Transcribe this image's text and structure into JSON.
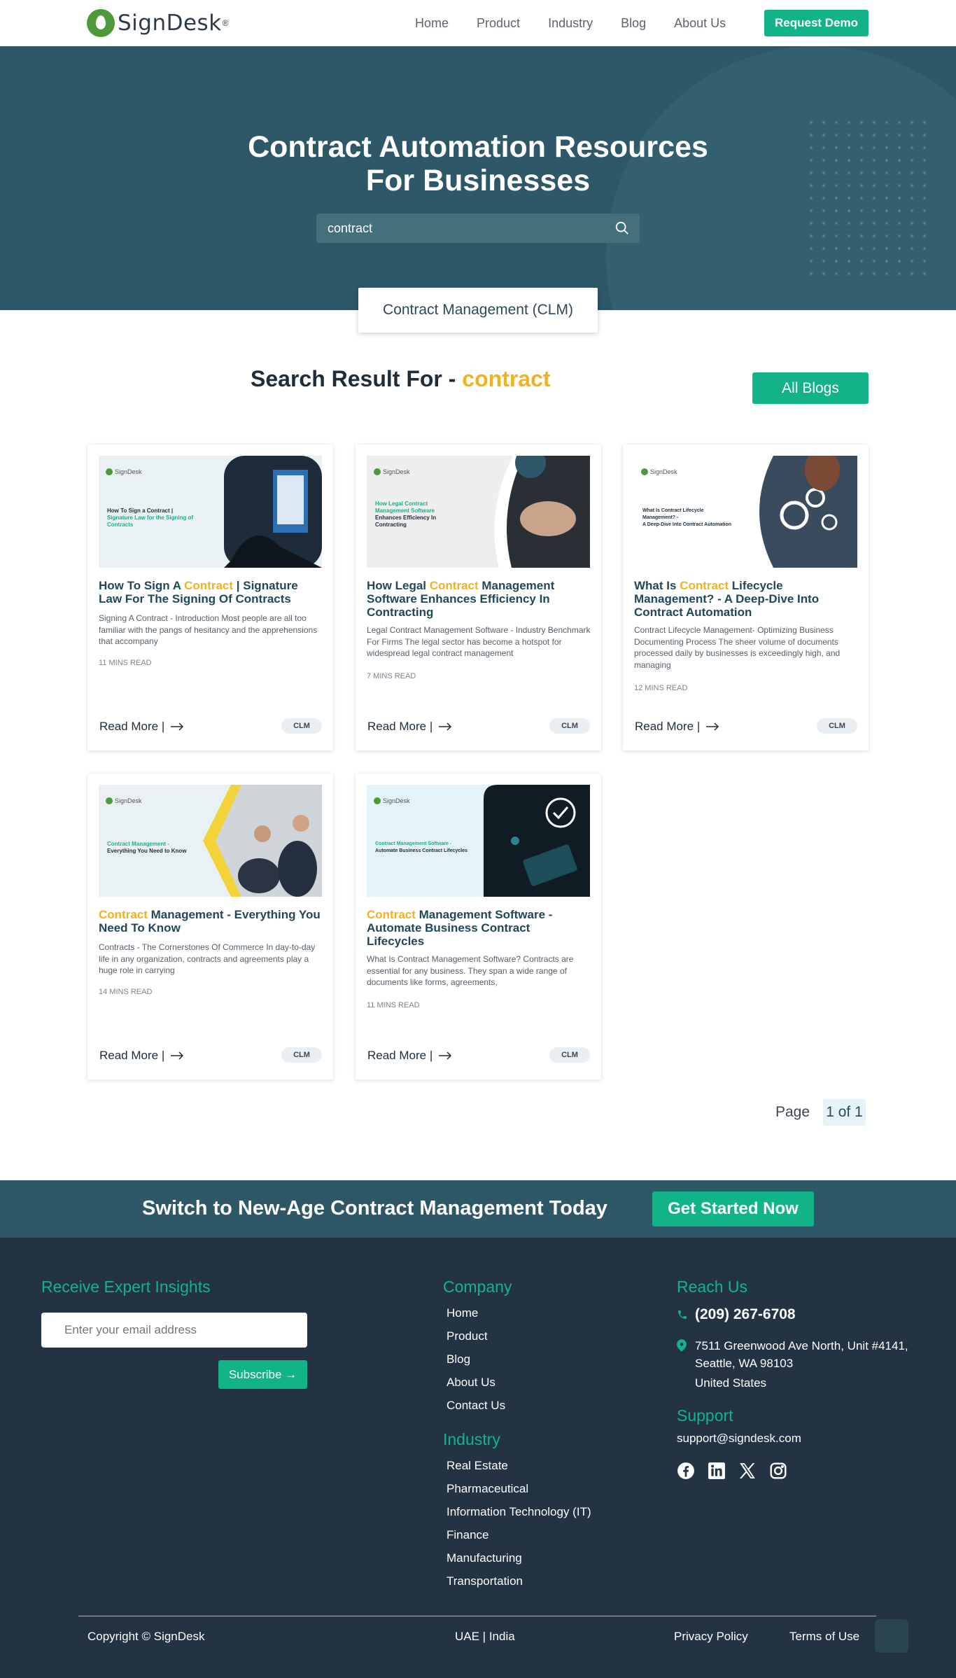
{
  "header": {
    "brand": "SignDesk",
    "brand_mark": "®",
    "nav": [
      "Home",
      "Product",
      "Industry",
      "Blog",
      "About Us"
    ],
    "demo_label": "Request Demo"
  },
  "hero": {
    "title_line1": "Contract Automation Resources",
    "title_line2": "For Businesses",
    "search_value": "contract",
    "tab_label": "Contract Management (CLM)"
  },
  "results": {
    "prefix": "Search Result For - ",
    "keyword": "contract",
    "all_blogs_label": "All Blogs"
  },
  "cards": [
    {
      "title_pre": "How To Sign A ",
      "title_kw": "Contract",
      "title_post": " | Signature Law For The Signing Of Contracts",
      "thumb_brand": "SignDesk",
      "thumb_line1": "How To Sign a Contract |",
      "thumb_line2": "Signature Law for the Signing of Contracts",
      "desc": "Signing A Contract - Introduction Most people are all too familiar with the pangs of hesitancy and the apprehensions that accompany",
      "read": "11 MINS READ",
      "more": "Read More |",
      "tag": "CLM"
    },
    {
      "title_pre": "How Legal ",
      "title_kw": "Contract",
      "title_post": " Management Software Enhances Efficiency In Contracting",
      "thumb_brand": "SignDesk",
      "thumb_line1": "How Legal Contract Management Software",
      "thumb_line2": "Enhances Efficiency In Contracting",
      "desc": "Legal Contract Management Software - Industry Benchmark For Firms The legal sector has become a hotspot for widespread legal contract management",
      "read": "7 MINS READ",
      "more": "Read More |",
      "tag": "CLM"
    },
    {
      "title_pre": "What Is ",
      "title_kw": "Contract",
      "title_post": " Lifecycle Management? - A Deep-Dive Into Contract Automation",
      "thumb_brand": "SignDesk",
      "thumb_line1": "What Is Contract Lifecycle Management? -",
      "thumb_line2": "A Deep-Dive Into Contract Automation",
      "desc": "Contract Lifecycle Management- Optimizing Business Documenting Process The sheer volume of documents processed daily by businesses is exceedingly high, and managing",
      "read": "12 MINS READ",
      "more": "Read More |",
      "tag": "CLM"
    },
    {
      "title_pre": "",
      "title_kw": "Contract",
      "title_post": " Management - Everything You Need To Know",
      "thumb_brand": "SignDesk",
      "thumb_line1": "Contract Management -",
      "thumb_line2": "Everything You Need to Know",
      "desc": "Contracts - The Cornerstones Of Commerce In day-to-day life in any organization, contracts and agreements play a huge role in carrying",
      "read": "14 MINS READ",
      "more": "Read More |",
      "tag": "CLM"
    },
    {
      "title_pre": "",
      "title_kw": "Contract",
      "title_post": " Management Software - Automate Business Contract Lifecycles",
      "thumb_brand": "SignDesk",
      "thumb_line1": "Contract Management Software -",
      "thumb_line2": "Automate Business Contract Lifecycles",
      "desc": "What Is Contract Management Software? Contracts are essential for any business. They span a wide range of documents like forms, agreements,",
      "read": "11 MINS READ",
      "more": "Read More |",
      "tag": "CLM"
    }
  ],
  "pagination": {
    "label": "Page",
    "value": "1 of 1"
  },
  "cta": {
    "text": "Switch to New-Age Contract Management Today",
    "button": "Get Started Now"
  },
  "footer": {
    "insights_head": "Receive Expert Insights",
    "email_placeholder": "Enter your email address",
    "subscribe": "Subscribe →",
    "company_head": "Company",
    "company_links": [
      "Home",
      "Product",
      "Blog",
      "About Us",
      "Contact Us"
    ],
    "industry_head": "Industry",
    "industry_links": [
      "Real Estate",
      "Pharmaceutical",
      "Information Technology (IT)",
      "Finance",
      "Manufacturing",
      "Transportation"
    ],
    "reach_head": "Reach Us",
    "phone": "(209) 267-6708",
    "address_lines": [
      "7511 Greenwood Ave North, Unit #4141,",
      "Seattle, WA 98103",
      "United States"
    ],
    "support_head": "Support",
    "support_email": "support@signdesk.com",
    "social_icons": [
      "facebook-icon",
      "linkedin-icon",
      "x-icon",
      "instagram-icon"
    ],
    "copyright": "Copyright © SignDesk",
    "regions": "UAE | India",
    "privacy": "Privacy Policy",
    "terms": "Terms of Use"
  },
  "colors": {
    "accent": "#13b38a",
    "hero_bg": "#2e5767",
    "footer_bg": "#233343",
    "keyword": "#f3b11c"
  }
}
